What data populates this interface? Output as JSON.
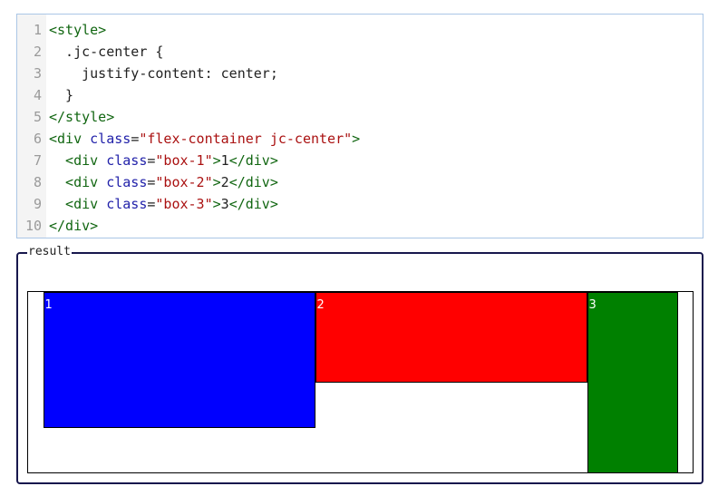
{
  "code_editor": {
    "lines": [
      {
        "number": "1",
        "tokens": [
          {
            "t": "<style>",
            "c": "tag"
          }
        ]
      },
      {
        "number": "2",
        "tokens": [
          {
            "t": "  .jc-center {",
            "c": "plain"
          }
        ]
      },
      {
        "number": "3",
        "tokens": [
          {
            "t": "    justify-content: center;",
            "c": "plain"
          }
        ]
      },
      {
        "number": "4",
        "tokens": [
          {
            "t": "  }",
            "c": "plain"
          }
        ]
      },
      {
        "number": "5",
        "tokens": [
          {
            "t": "</style>",
            "c": "tag"
          }
        ]
      },
      {
        "number": "6",
        "tokens": [
          {
            "t": "<div ",
            "c": "tag"
          },
          {
            "t": "class",
            "c": "attr"
          },
          {
            "t": "=",
            "c": "plain"
          },
          {
            "t": "\"flex-container jc-center\"",
            "c": "val"
          },
          {
            "t": ">",
            "c": "tag"
          }
        ]
      },
      {
        "number": "7",
        "tokens": [
          {
            "t": "  <div ",
            "c": "tag"
          },
          {
            "t": "class",
            "c": "attr"
          },
          {
            "t": "=",
            "c": "plain"
          },
          {
            "t": "\"box-1\"",
            "c": "val"
          },
          {
            "t": ">",
            "c": "tag"
          },
          {
            "t": "1",
            "c": "plain"
          },
          {
            "t": "</div>",
            "c": "tag"
          }
        ]
      },
      {
        "number": "8",
        "tokens": [
          {
            "t": "  <div ",
            "c": "tag"
          },
          {
            "t": "class",
            "c": "attr"
          },
          {
            "t": "=",
            "c": "plain"
          },
          {
            "t": "\"box-2\"",
            "c": "val"
          },
          {
            "t": ">",
            "c": "tag"
          },
          {
            "t": "2",
            "c": "plain"
          },
          {
            "t": "</div>",
            "c": "tag"
          }
        ]
      },
      {
        "number": "9",
        "tokens": [
          {
            "t": "  <div ",
            "c": "tag"
          },
          {
            "t": "class",
            "c": "attr"
          },
          {
            "t": "=",
            "c": "plain"
          },
          {
            "t": "\"box-3\"",
            "c": "val"
          },
          {
            "t": ">",
            "c": "tag"
          },
          {
            "t": "3",
            "c": "plain"
          },
          {
            "t": "</div>",
            "c": "tag"
          }
        ]
      },
      {
        "number": "10",
        "tokens": [
          {
            "t": "</div>",
            "c": "tag"
          }
        ]
      }
    ],
    "colors": {
      "tag": "#116611",
      "attr": "#2222aa",
      "val": "#aa1111",
      "plain": "#222222",
      "border": "#aac6e6"
    }
  },
  "result": {
    "legend": "result",
    "boxes": [
      {
        "label": "1",
        "color": "#0000ff"
      },
      {
        "label": "2",
        "color": "#ff0000"
      },
      {
        "label": "3",
        "color": "#008000"
      }
    ],
    "border_color": "#17174d"
  }
}
